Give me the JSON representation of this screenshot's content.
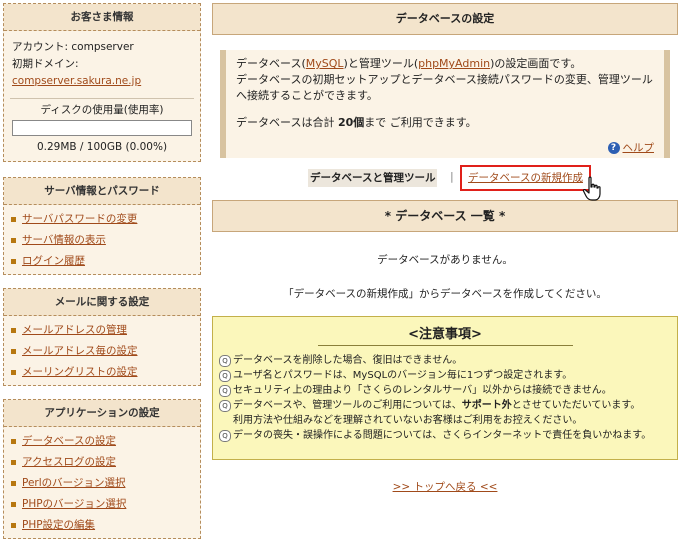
{
  "sidebar": {
    "customer": {
      "title": "お客さま情報",
      "account_label": "アカウント: ",
      "account_value": "compserver",
      "domain_label": "初期ドメイン: ",
      "domain_value": "compserver.sakura.ne.jp",
      "disk_title": "ディスクの使用量(使用率)",
      "disk_usage": "0.29MB / 100GB (0.00%)",
      "disk_fraction": 0.0
    },
    "server": {
      "title": "サーバ情報とパスワード",
      "items": [
        "サーバパスワードの変更",
        "サーバ情報の表示",
        "ログイン履歴"
      ]
    },
    "mail": {
      "title": "メールに関する設定",
      "items": [
        "メールアドレスの管理",
        "メールアドレス毎の設定",
        "メーリングリストの設定"
      ]
    },
    "apps": {
      "title": "アプリケーションの設定",
      "items": [
        "データベースの設定",
        "アクセスログの設定",
        "Perlのバージョン選択",
        "PHPのバージョン選択",
        "PHP設定の編集"
      ]
    }
  },
  "main": {
    "header": "データベースの設定",
    "intro": {
      "line1_a": "データベース(",
      "mysql": "MySQL",
      "line1_b": ")と管理ツール(",
      "phpmyadmin": "phpMyAdmin",
      "line1_c": ")の設定画面です。",
      "line2": "データベースの初期セットアップとデータベース接続パスワードの変更、管理ツールへ接続することができます。",
      "total_a": "データベースは合計 ",
      "total_count": "20個",
      "total_b": "まで ご利用できます。",
      "help": "ヘルプ"
    },
    "tabs": {
      "active": "データベースと管理ツール",
      "separator": "|",
      "new": "データベースの新規作成"
    },
    "list_header": "* データベース 一覧 *",
    "empty_message": "データベースがありません。",
    "hint": "「データベースの新規作成」からデータベースを作成してください。",
    "notice": {
      "title": "<注意事項>",
      "items": [
        "データベースを削除した場合、復旧はできません。",
        "ユーザ名とパスワードは、MySQLのバージョン毎に1つずつ設定されます。",
        "セキュリティ上の理由より「さくらのレンタルサーバ」以外からは接続できません。",
        "データベースや、管理ツールのご利用については、サポート外とさせていただいています。",
        "データの喪失・誤操作による問題については、さくらインターネットで責任を負いかねます。"
      ],
      "item4_cont": "利用方法や仕組みなどを理解されていないお客様はご利用をお控えください。",
      "q_icon": "Q"
    },
    "back_link": ">> トップへ戻る <<"
  },
  "colors": {
    "link": "#a04a1a",
    "highlight_border": "#e0201a",
    "header_bg": "#f3e4cc",
    "notice_bg": "#fbf7bb",
    "help_icon": "#2d5fb3"
  },
  "icons": {
    "help": "question-circle-icon",
    "cursor": "hand-pointer-icon",
    "bullet": "square-bullet-icon",
    "note": "q-bullet-icon"
  }
}
